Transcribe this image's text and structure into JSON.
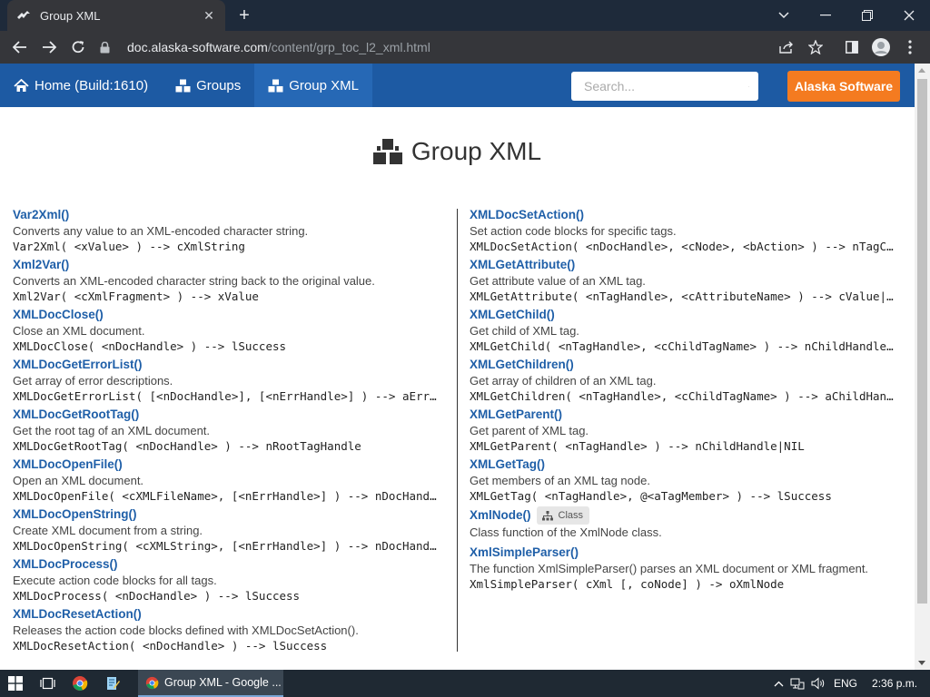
{
  "browser": {
    "tab_title": "Group XML",
    "url_host": "doc.alaska-software.com",
    "url_path": "/content/grp_toc_l2_xml.html"
  },
  "sitenav": {
    "items": [
      {
        "label": "Home (Build:1610)",
        "icon": "home-icon"
      },
      {
        "label": "Groups",
        "icon": "cubes-icon"
      },
      {
        "label": "Group XML",
        "icon": "cubes-icon"
      }
    ],
    "search_placeholder": "Search...",
    "brand_label": "Alaska Software"
  },
  "page": {
    "title": "Group XML"
  },
  "left_entries": [
    {
      "name": "Var2Xml()",
      "desc": "Converts any value to an XML-encoded character string.",
      "sig": "Var2Xml( <xValue> ) --> cXmlString"
    },
    {
      "name": "Xml2Var()",
      "desc": "Converts an XML-encoded character string back to the original value.",
      "sig": "Xml2Var( <cXmlFragment> ) --> xValue"
    },
    {
      "name": "XMLDocClose()",
      "desc": "Close an XML document.",
      "sig": "XMLDocClose( <nDocHandle> ) --> lSuccess"
    },
    {
      "name": "XMLDocGetErrorList()",
      "desc": "Get array of error descriptions.",
      "sig": "XMLDocGetErrorList( [<nDocHandle>], [<nErrHandle>] ) --> aErrorList"
    },
    {
      "name": "XMLDocGetRootTag()",
      "desc": "Get the root tag of an XML document.",
      "sig": "XMLDocGetRootTag( <nDocHandle> ) --> nRootTagHandle"
    },
    {
      "name": "XMLDocOpenFile()",
      "desc": "Open an XML document.",
      "sig": "XMLDocOpenFile( <cXMLFileName>, [<nErrHandle>] ) --> nDocHandle"
    },
    {
      "name": "XMLDocOpenString()",
      "desc": "Create XML document from a string.",
      "sig": "XMLDocOpenString( <cXMLString>, [<nErrHandle>] ) --> nDocHandle"
    },
    {
      "name": "XMLDocProcess()",
      "desc": "Execute action code blocks for all tags.",
      "sig": "XMLDocProcess( <nDocHandle> ) --> lSuccess"
    },
    {
      "name": "XMLDocResetAction()",
      "desc": "Releases the action code blocks defined with XMLDocSetAction().",
      "sig": "XMLDocResetAction( <nDocHandle> ) --> lSuccess"
    }
  ],
  "right_entries": [
    {
      "name": "XMLDocSetAction()",
      "desc": "Set action code blocks for specific tags.",
      "sig": "XMLDocSetAction( <nDocHandle>, <cNode>, <bAction> ) --> nTagCount"
    },
    {
      "name": "XMLGetAttribute()",
      "desc": "Get attribute value of an XML tag.",
      "sig": "XMLGetAttribute( <nTagHandle>, <cAttributeName> ) --> cValue|NIL"
    },
    {
      "name": "XMLGetChild()",
      "desc": "Get child of XML tag.",
      "sig": "XMLGetChild( <nTagHandle>, <cChildTagName> ) --> nChildHandle|NIL"
    },
    {
      "name": "XMLGetChildren()",
      "desc": "Get array of children of an XML tag.",
      "sig": "XMLGetChildren( <nTagHandle>, <cChildTagName> ) --> aChildHandles"
    },
    {
      "name": "XMLGetParent()",
      "desc": "Get parent of XML tag.",
      "sig": "XMLGetParent( <nTagHandle> ) --> nChildHandle|NIL"
    },
    {
      "name": "XMLGetTag()",
      "desc": "Get members of an XML tag node.",
      "sig": "XMLGetTag( <nTagHandle>, @<aTagMember> ) --> lSuccess"
    },
    {
      "name": "XmlNode()",
      "badge": "Class",
      "desc": "Class function of the XmlNode class.",
      "sig": ""
    },
    {
      "name": "XmlSimpleParser()",
      "desc": "The function XmlSimpleParser() parses an XML document or XML fragment.",
      "sig": "XmlSimpleParser( cXml [, coNode] ) -> oXmlNode"
    }
  ],
  "taskbar": {
    "app_label": "Group XML - Google ...",
    "language": "ENG",
    "time": "2:36 p.m."
  }
}
